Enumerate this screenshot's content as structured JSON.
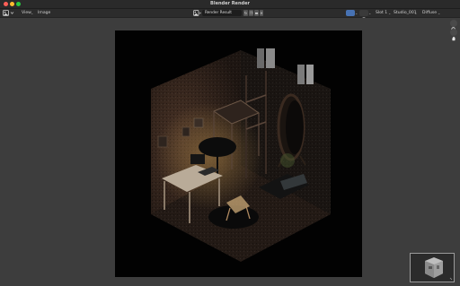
{
  "window": {
    "title": "Blender Render"
  },
  "toolbar": {
    "menu_view": "View",
    "menu_image": "Image",
    "image_name": "Render Result",
    "slot": "Slot 1",
    "view_layer": "Studio_001",
    "pass": "Diffuse"
  },
  "colors": {
    "accent": "#4772b3",
    "close": "#ff5f57",
    "minimize": "#febc2e",
    "maximize": "#28c840"
  }
}
